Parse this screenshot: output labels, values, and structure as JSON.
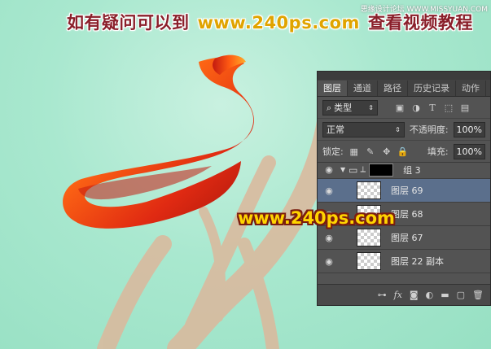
{
  "banner": {
    "text_left": "如有疑问可以到",
    "url": "www.240ps.com",
    "text_right": "查看视频教程"
  },
  "corner": {
    "text": "思缘设计论坛 WWW.MISSYUAN.COM"
  },
  "watermark": {
    "text": "www.240ps.com"
  },
  "panel": {
    "tabs": [
      "图层",
      "通道",
      "路径",
      "历史记录",
      "动作"
    ],
    "active_tab": 0,
    "filter": {
      "label": "类型"
    },
    "blend_mode": "正常",
    "opacity": {
      "label": "不透明度:",
      "value": "100%"
    },
    "lock": {
      "label": "锁定:"
    },
    "fill": {
      "label": "填充:",
      "value": "100%"
    },
    "layers": [
      {
        "name": "组 3",
        "type": "group",
        "selected": false
      },
      {
        "name": "图层 69",
        "type": "layer",
        "selected": true
      },
      {
        "name": "图层 68",
        "type": "layer",
        "selected": false
      },
      {
        "name": "图层 67",
        "type": "layer",
        "selected": false
      },
      {
        "name": "图层 22 副本",
        "type": "layer",
        "selected": false
      }
    ],
    "footer_icons": [
      "link-icon",
      "fx-icon",
      "mask-icon",
      "adjustment-icon",
      "folder-icon",
      "new-layer-icon",
      "trash-icon"
    ]
  },
  "colors": {
    "background": "#a9e8cf",
    "banner_text": "#8a1f2a",
    "banner_url": "#e0a400",
    "watermark_fill": "#ffd400",
    "watermark_stroke": "#7a1e10",
    "ribbon": "#d8301a",
    "ghost_stroke": "#d9b99f"
  }
}
